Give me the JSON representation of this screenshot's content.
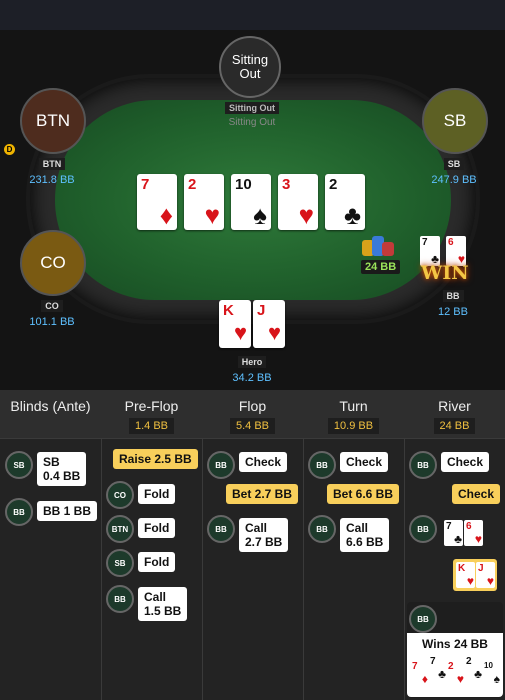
{
  "table": {
    "seats": [
      {
        "id": "sitting-out",
        "avatar_text": "Sitting\nOut",
        "label": "Sitting Out",
        "status": "Sitting Out"
      },
      {
        "id": "btn",
        "avatar_text": "BTN",
        "label": "BTN",
        "stack": "231.8 BB",
        "dealer": "D"
      },
      {
        "id": "sb",
        "avatar_text": "SB",
        "label": "SB",
        "stack": "247.9 BB"
      },
      {
        "id": "co",
        "avatar_text": "CO",
        "label": "CO",
        "stack": "101.1 BB"
      },
      {
        "id": "bb",
        "label": "BB",
        "stack": "12 BB",
        "hole_cards": [
          {
            "rank": "7",
            "suit": "♣",
            "color": "black"
          },
          {
            "rank": "6",
            "suit": "♥",
            "color": "red"
          }
        ]
      },
      {
        "id": "hero",
        "label": "Hero",
        "stack": "34.2 BB",
        "hole_cards": [
          {
            "rank": "K",
            "suit": "♥",
            "color": "red"
          },
          {
            "rank": "J",
            "suit": "♥",
            "color": "red"
          }
        ]
      }
    ],
    "board": [
      {
        "rank": "7",
        "suit": "♦",
        "color": "red"
      },
      {
        "rank": "2",
        "suit": "♥",
        "color": "red"
      },
      {
        "rank": "10",
        "suit": "♠",
        "color": "black"
      },
      {
        "rank": "3",
        "suit": "♥",
        "color": "red"
      },
      {
        "rank": "2",
        "suit": "♣",
        "color": "black"
      }
    ],
    "pot": "24 BB",
    "win_badge": "WIN"
  },
  "history": {
    "columns": [
      {
        "title": "Blinds (Ante)",
        "pot": ""
      },
      {
        "title": "Pre-Flop",
        "pot": "1.4 BB"
      },
      {
        "title": "Flop",
        "pot": "5.4 BB"
      },
      {
        "title": "Turn",
        "pot": "10.9 BB"
      },
      {
        "title": "River",
        "pot": "24 BB"
      }
    ],
    "blinds": [
      {
        "pos": "SB",
        "action": "SB\n0.4 BB"
      },
      {
        "pos": "BB",
        "action": "BB 1 BB"
      }
    ],
    "preflop": [
      {
        "pos": "",
        "action": "Raise 2.5 BB",
        "gold": true
      },
      {
        "pos": "CO",
        "action": "Fold"
      },
      {
        "pos": "BTN",
        "action": "Fold"
      },
      {
        "pos": "SB",
        "action": "Fold"
      },
      {
        "pos": "BB",
        "action": "Call\n1.5 BB"
      }
    ],
    "flop": [
      {
        "pos": "BB",
        "action": "Check"
      },
      {
        "pos": "",
        "action": "Bet 2.7 BB",
        "gold": true
      },
      {
        "pos": "BB",
        "action": "Call\n2.7 BB"
      }
    ],
    "turn": [
      {
        "pos": "BB",
        "action": "Check"
      },
      {
        "pos": "",
        "action": "Bet 6.6 BB",
        "gold": true
      },
      {
        "pos": "BB",
        "action": "Call\n6.6 BB"
      }
    ],
    "river": [
      {
        "pos": "BB",
        "action": "Check"
      },
      {
        "pos": "",
        "action": "Check",
        "gold": true
      },
      {
        "pos": "BB",
        "cards": [
          {
            "rank": "7",
            "suit": "♣",
            "color": "black"
          },
          {
            "rank": "6",
            "suit": "♥",
            "color": "red"
          }
        ]
      },
      {
        "pos": "",
        "cards": [
          {
            "rank": "K",
            "suit": "♥",
            "color": "red"
          },
          {
            "rank": "J",
            "suit": "♥",
            "color": "red"
          }
        ]
      },
      {
        "pos": "BB",
        "result": "Wins 24 BB",
        "cards": [
          {
            "rank": "7",
            "suit": "♦",
            "color": "red"
          },
          {
            "rank": "7",
            "suit": "♣",
            "color": "black"
          },
          {
            "rank": "2",
            "suit": "♥",
            "color": "red"
          },
          {
            "rank": "2",
            "suit": "♣",
            "color": "black"
          },
          {
            "rank": "10",
            "suit": "♠",
            "color": "black"
          }
        ]
      }
    ]
  }
}
